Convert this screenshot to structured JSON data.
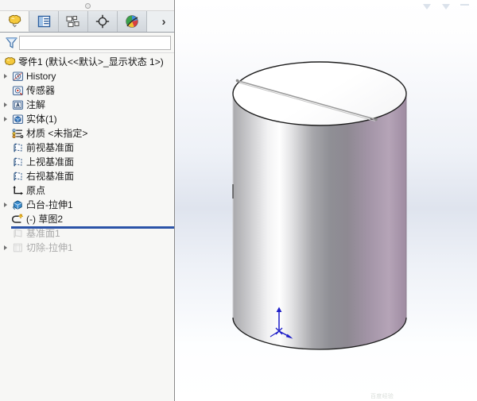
{
  "panel": {
    "tabs": [
      {
        "name": "feature-manager-design-tree",
        "icon": "feature-tree-icon",
        "active": true
      },
      {
        "name": "property-manager",
        "icon": "property-list-icon",
        "active": false
      },
      {
        "name": "configuration-manager",
        "icon": "configuration-icon",
        "active": false
      },
      {
        "name": "dimxpert-manager",
        "icon": "dimxpert-crosshair-icon",
        "active": false
      },
      {
        "name": "display-manager",
        "icon": "display-color-wheel-icon",
        "active": false
      }
    ],
    "overflow_label": "›",
    "filter": {
      "icon": "filter-funnel-icon",
      "value": "",
      "placeholder": ""
    }
  },
  "tree": {
    "root": {
      "label": "零件1  (默认<<默认>_显示状态 1>)",
      "icon": "part-icon"
    },
    "items": [
      {
        "label": "History",
        "icon": "history-icon",
        "expandable": true,
        "indent": 1,
        "dim": false,
        "selected": false
      },
      {
        "label": "传感器",
        "icon": "sensors-icon",
        "expandable": false,
        "indent": 1,
        "dim": false,
        "selected": false
      },
      {
        "label": "注解",
        "icon": "annotations-icon",
        "expandable": true,
        "indent": 1,
        "dim": false,
        "selected": false
      },
      {
        "label": "实体(1)",
        "icon": "solid-bodies-icon",
        "expandable": true,
        "indent": 1,
        "dim": false,
        "selected": false
      },
      {
        "label": "材质 <未指定>",
        "icon": "material-icon",
        "expandable": false,
        "indent": 1,
        "dim": false,
        "selected": false
      },
      {
        "label": "前视基准面",
        "icon": "plane-icon",
        "expandable": false,
        "indent": 1,
        "dim": false,
        "selected": false
      },
      {
        "label": "上视基准面",
        "icon": "plane-icon",
        "expandable": false,
        "indent": 1,
        "dim": false,
        "selected": false
      },
      {
        "label": "右视基准面",
        "icon": "plane-icon",
        "expandable": false,
        "indent": 1,
        "dim": false,
        "selected": false
      },
      {
        "label": "原点",
        "icon": "origin-icon",
        "expandable": false,
        "indent": 1,
        "dim": false,
        "selected": false
      },
      {
        "label": "凸台-拉伸1",
        "icon": "boss-extrude-icon",
        "expandable": true,
        "indent": 1,
        "dim": false,
        "selected": false
      },
      {
        "label": "(-) 草图2",
        "icon": "sketch-icon",
        "expandable": false,
        "indent": 1,
        "dim": false,
        "selected": true
      },
      {
        "label": "基准面1",
        "icon": "plane-gray-icon",
        "expandable": false,
        "indent": 1,
        "dim": true,
        "selected": false
      },
      {
        "label": "切除-拉伸1",
        "icon": "cut-extrude-icon",
        "expandable": true,
        "indent": 1,
        "dim": true,
        "selected": false
      }
    ],
    "rollback_bar": {
      "name": "rollback-bar",
      "after_item_index": 10
    }
  },
  "viewport": {
    "model": {
      "name": "cylinder-part",
      "top_face_color": "#ffffff",
      "body_highlight": "#ffffff",
      "body_shadow": "#8d8d93",
      "body_tint": "#b3a1b5",
      "edge_color": "#2a2a2a",
      "sketch_line_color": "#8d8d8d"
    },
    "origin_triad": {
      "name": "origin-triad",
      "color": "#1f1fc8"
    },
    "watermark": "百度经验"
  }
}
